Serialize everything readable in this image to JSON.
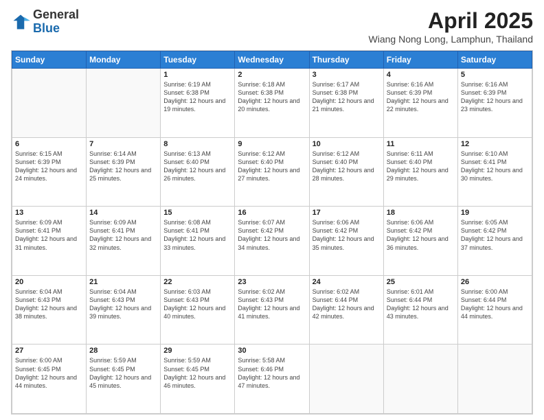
{
  "header": {
    "logo": {
      "line1": "General",
      "line2": "Blue"
    },
    "title": "April 2025",
    "location": "Wiang Nong Long, Lamphun, Thailand"
  },
  "days_of_week": [
    "Sunday",
    "Monday",
    "Tuesday",
    "Wednesday",
    "Thursday",
    "Friday",
    "Saturday"
  ],
  "weeks": [
    [
      {
        "day": "",
        "info": ""
      },
      {
        "day": "",
        "info": ""
      },
      {
        "day": "1",
        "info": "Sunrise: 6:19 AM\nSunset: 6:38 PM\nDaylight: 12 hours and 19 minutes."
      },
      {
        "day": "2",
        "info": "Sunrise: 6:18 AM\nSunset: 6:38 PM\nDaylight: 12 hours and 20 minutes."
      },
      {
        "day": "3",
        "info": "Sunrise: 6:17 AM\nSunset: 6:38 PM\nDaylight: 12 hours and 21 minutes."
      },
      {
        "day": "4",
        "info": "Sunrise: 6:16 AM\nSunset: 6:39 PM\nDaylight: 12 hours and 22 minutes."
      },
      {
        "day": "5",
        "info": "Sunrise: 6:16 AM\nSunset: 6:39 PM\nDaylight: 12 hours and 23 minutes."
      }
    ],
    [
      {
        "day": "6",
        "info": "Sunrise: 6:15 AM\nSunset: 6:39 PM\nDaylight: 12 hours and 24 minutes."
      },
      {
        "day": "7",
        "info": "Sunrise: 6:14 AM\nSunset: 6:39 PM\nDaylight: 12 hours and 25 minutes."
      },
      {
        "day": "8",
        "info": "Sunrise: 6:13 AM\nSunset: 6:40 PM\nDaylight: 12 hours and 26 minutes."
      },
      {
        "day": "9",
        "info": "Sunrise: 6:12 AM\nSunset: 6:40 PM\nDaylight: 12 hours and 27 minutes."
      },
      {
        "day": "10",
        "info": "Sunrise: 6:12 AM\nSunset: 6:40 PM\nDaylight: 12 hours and 28 minutes."
      },
      {
        "day": "11",
        "info": "Sunrise: 6:11 AM\nSunset: 6:40 PM\nDaylight: 12 hours and 29 minutes."
      },
      {
        "day": "12",
        "info": "Sunrise: 6:10 AM\nSunset: 6:41 PM\nDaylight: 12 hours and 30 minutes."
      }
    ],
    [
      {
        "day": "13",
        "info": "Sunrise: 6:09 AM\nSunset: 6:41 PM\nDaylight: 12 hours and 31 minutes."
      },
      {
        "day": "14",
        "info": "Sunrise: 6:09 AM\nSunset: 6:41 PM\nDaylight: 12 hours and 32 minutes."
      },
      {
        "day": "15",
        "info": "Sunrise: 6:08 AM\nSunset: 6:41 PM\nDaylight: 12 hours and 33 minutes."
      },
      {
        "day": "16",
        "info": "Sunrise: 6:07 AM\nSunset: 6:42 PM\nDaylight: 12 hours and 34 minutes."
      },
      {
        "day": "17",
        "info": "Sunrise: 6:06 AM\nSunset: 6:42 PM\nDaylight: 12 hours and 35 minutes."
      },
      {
        "day": "18",
        "info": "Sunrise: 6:06 AM\nSunset: 6:42 PM\nDaylight: 12 hours and 36 minutes."
      },
      {
        "day": "19",
        "info": "Sunrise: 6:05 AM\nSunset: 6:42 PM\nDaylight: 12 hours and 37 minutes."
      }
    ],
    [
      {
        "day": "20",
        "info": "Sunrise: 6:04 AM\nSunset: 6:43 PM\nDaylight: 12 hours and 38 minutes."
      },
      {
        "day": "21",
        "info": "Sunrise: 6:04 AM\nSunset: 6:43 PM\nDaylight: 12 hours and 39 minutes."
      },
      {
        "day": "22",
        "info": "Sunrise: 6:03 AM\nSunset: 6:43 PM\nDaylight: 12 hours and 40 minutes."
      },
      {
        "day": "23",
        "info": "Sunrise: 6:02 AM\nSunset: 6:43 PM\nDaylight: 12 hours and 41 minutes."
      },
      {
        "day": "24",
        "info": "Sunrise: 6:02 AM\nSunset: 6:44 PM\nDaylight: 12 hours and 42 minutes."
      },
      {
        "day": "25",
        "info": "Sunrise: 6:01 AM\nSunset: 6:44 PM\nDaylight: 12 hours and 43 minutes."
      },
      {
        "day": "26",
        "info": "Sunrise: 6:00 AM\nSunset: 6:44 PM\nDaylight: 12 hours and 44 minutes."
      }
    ],
    [
      {
        "day": "27",
        "info": "Sunrise: 6:00 AM\nSunset: 6:45 PM\nDaylight: 12 hours and 44 minutes."
      },
      {
        "day": "28",
        "info": "Sunrise: 5:59 AM\nSunset: 6:45 PM\nDaylight: 12 hours and 45 minutes."
      },
      {
        "day": "29",
        "info": "Sunrise: 5:59 AM\nSunset: 6:45 PM\nDaylight: 12 hours and 46 minutes."
      },
      {
        "day": "30",
        "info": "Sunrise: 5:58 AM\nSunset: 6:46 PM\nDaylight: 12 hours and 47 minutes."
      },
      {
        "day": "",
        "info": ""
      },
      {
        "day": "",
        "info": ""
      },
      {
        "day": "",
        "info": ""
      }
    ]
  ]
}
